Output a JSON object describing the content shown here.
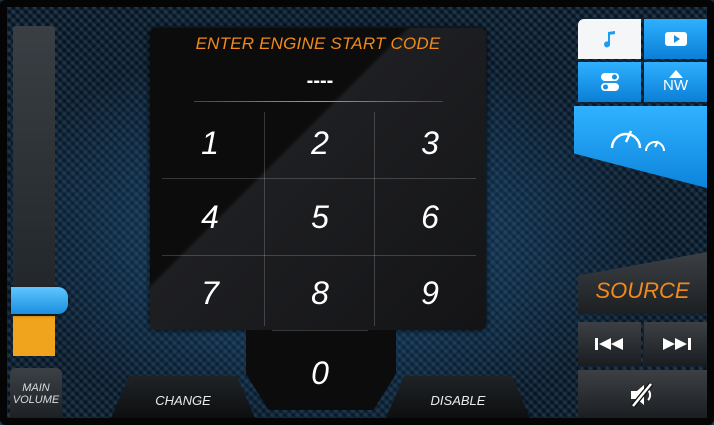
{
  "keypad": {
    "title": "ENTER ENGINE START CODE",
    "code": "----",
    "keys": [
      "1",
      "2",
      "3",
      "4",
      "5",
      "6",
      "7",
      "8",
      "9"
    ],
    "zero": "0"
  },
  "bottom": {
    "change_label": "CHANGE",
    "disable_label": "DISABLE"
  },
  "volume": {
    "label_line1": "MAIN",
    "label_line2": "VOLUME"
  },
  "right_panel": {
    "source_label": "SOURCE",
    "nav_label": "NW",
    "icons": [
      "music-note-icon",
      "video-play-icon",
      "toggle-settings-icon",
      "compass-nw-icon",
      "gauges-icon",
      "previous-track-icon",
      "next-track-icon",
      "mute-icon"
    ]
  },
  "colors": {
    "accent_orange": "#f08a1c",
    "accent_blue": "#1a9cf0",
    "volume_fill": "#f0a31c"
  }
}
